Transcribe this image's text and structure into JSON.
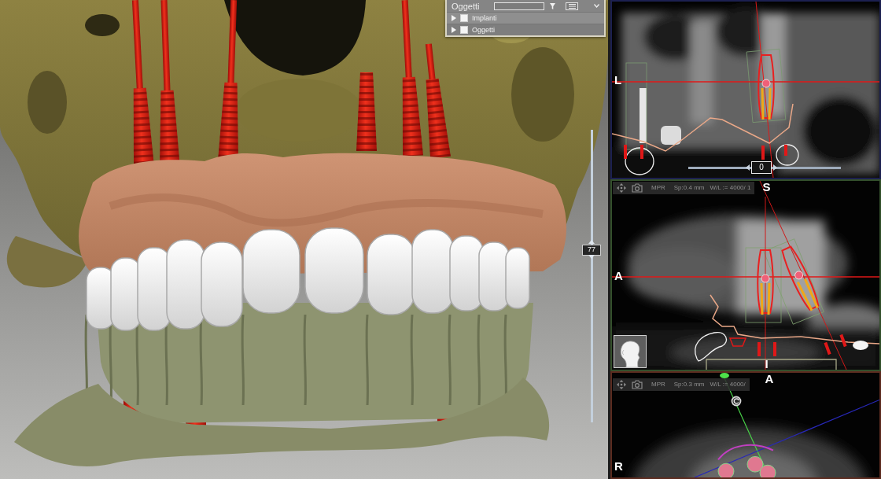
{
  "viewport_3d": {
    "objects_panel": {
      "title": "Oggetti",
      "items": [
        {
          "label": "Implanti",
          "expanded": false,
          "checked": false
        },
        {
          "label": "Oggetti",
          "expanded": false,
          "checked": false
        }
      ]
    },
    "depth_slider": {
      "value": "77",
      "level": 0.59
    }
  },
  "slice_views": [
    {
      "kind": "coronal",
      "color": "#1c2050",
      "labels": [
        {
          "text": "L",
          "kind": "left"
        }
      ],
      "slider": {
        "value": "0",
        "level": 0.48
      }
    },
    {
      "kind": "sagittal",
      "color": "#34502c",
      "toolbar": {
        "mode": "MPR",
        "spacing": "Sp:0.4 mm",
        "window_level": "W/L := 4000/ 1"
      },
      "labels": [
        {
          "text": "S",
          "kind": "top"
        },
        {
          "text": "A",
          "kind": "left"
        },
        {
          "text": "I",
          "kind": "bottom"
        }
      ]
    },
    {
      "kind": "axial",
      "color": "#5c2c20",
      "toolbar": {
        "mode": "MPR",
        "spacing": "Sp:0.3 mm",
        "window_level": "W/L := 4000/"
      },
      "labels": [
        {
          "text": "A",
          "kind": "top"
        },
        {
          "text": "R",
          "kind": "left"
        }
      ]
    }
  ]
}
